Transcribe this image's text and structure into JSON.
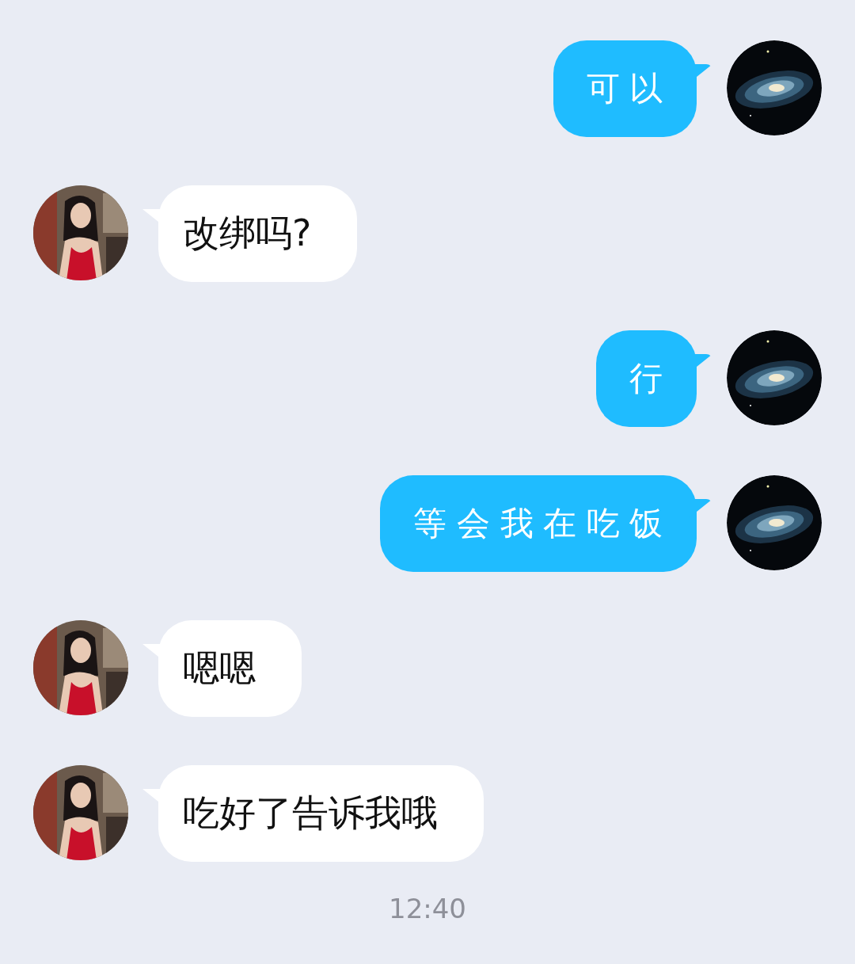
{
  "messages": [
    {
      "kind": "sent",
      "text": "可以"
    },
    {
      "kind": "received",
      "text": "改绑吗?"
    },
    {
      "kind": "sent",
      "text": "行"
    },
    {
      "kind": "sent",
      "text": "等会我在吃饭"
    },
    {
      "kind": "received",
      "text": "嗯嗯"
    },
    {
      "kind": "received",
      "text": "吃好了告诉我哦"
    }
  ],
  "time": "12:40"
}
